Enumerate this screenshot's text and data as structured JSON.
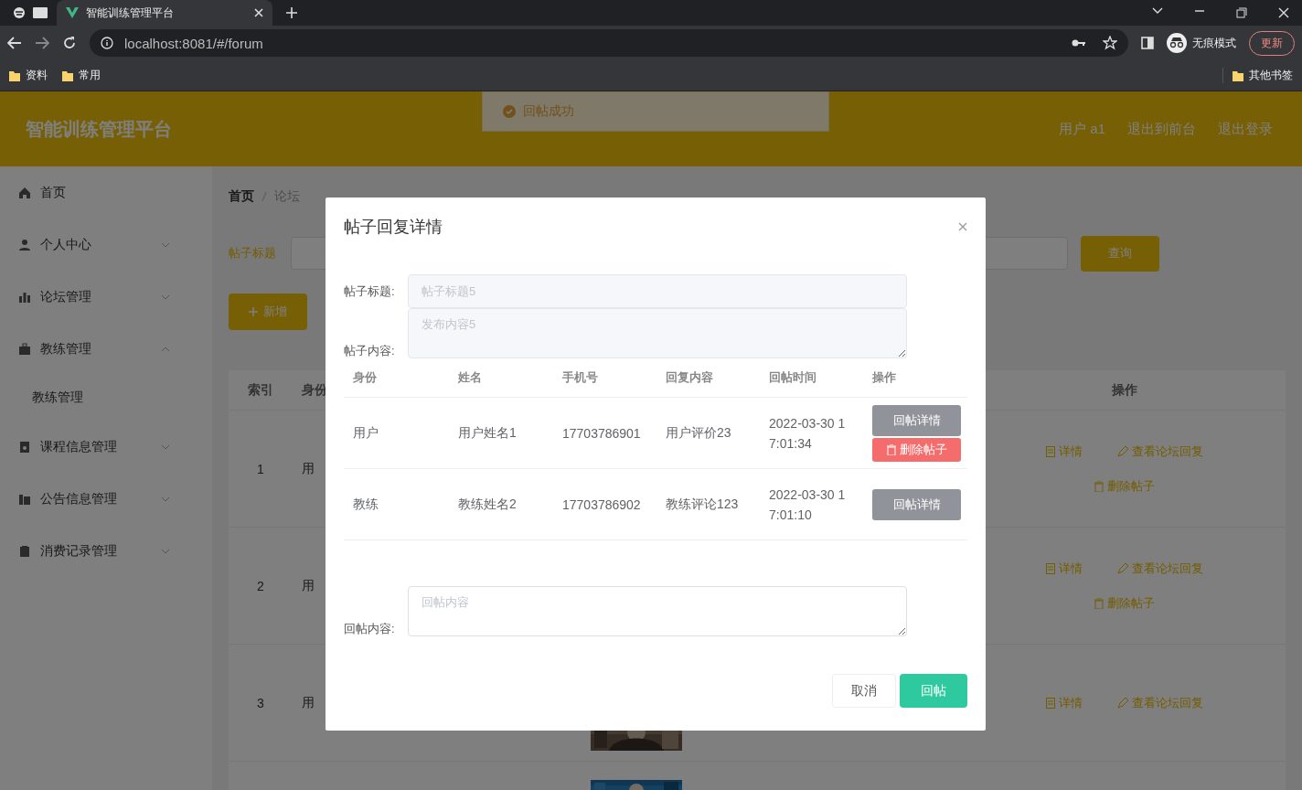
{
  "browser": {
    "tabs": [
      {
        "title": "智能训练管理平台",
        "selected": true
      }
    ],
    "url": "localhost:8081/#/forum",
    "profile": "无痕模式",
    "update_button": "更新",
    "bookmarks": [
      "资料",
      "常用"
    ],
    "other_bookmarks": "其他书签"
  },
  "app": {
    "title": "智能训练管理平台",
    "header_links": [
      "用户 a1",
      "退出到前台",
      "退出登录"
    ],
    "toast": "回帖成功",
    "sidebar": {
      "items": [
        {
          "label": "首页",
          "kind": "link"
        },
        {
          "label": "个人中心",
          "kind": "menu",
          "expanded": false
        },
        {
          "label": "论坛管理",
          "kind": "menu",
          "expanded": false
        },
        {
          "label": "教练管理",
          "kind": "menu",
          "expanded": true,
          "children": [
            {
              "label": "教练管理"
            }
          ]
        },
        {
          "label": "课程信息管理",
          "kind": "menu",
          "expanded": false
        },
        {
          "label": "公告信息管理",
          "kind": "menu",
          "expanded": false
        },
        {
          "label": "消费记录管理",
          "kind": "menu",
          "expanded": false
        }
      ]
    },
    "breadcrumb": [
      "首页",
      "论坛"
    ],
    "search": {
      "label": "帖子标题",
      "button": "查询"
    },
    "add_button": "新增",
    "table": {
      "columns": [
        "索引",
        "身份",
        "操作"
      ],
      "rows": [
        {
          "index": "1",
          "identity": "用",
          "actions": [
            {
              "label": "详情",
              "kind": "detail"
            },
            {
              "label": "查看论坛回复",
              "kind": "replies"
            },
            {
              "label": "删除帖子",
              "kind": "delete"
            }
          ]
        },
        {
          "index": "2",
          "identity": "用",
          "actions": [
            {
              "label": "详情",
              "kind": "detail"
            },
            {
              "label": "查看论坛回复",
              "kind": "replies"
            },
            {
              "label": "删除帖子",
              "kind": "delete"
            }
          ]
        },
        {
          "index": "3",
          "identity": "用",
          "picture": {
            "kind": "picture"
          },
          "actions": [
            {
              "label": "详情",
              "kind": "detail"
            },
            {
              "label": "查看论坛回复",
              "kind": "replies"
            }
          ]
        },
        {
          "picture": {
            "kind": "picture"
          }
        }
      ]
    }
  },
  "modal": {
    "title": "帖子回复详情",
    "post_title": {
      "label": "帖子标题:",
      "value": "帖子标题5",
      "disabled": true
    },
    "post_content": {
      "label": "帖子内容:",
      "value": "发布内容5",
      "disabled": true
    },
    "replies": {
      "columns": [
        "身份",
        "姓名",
        "手机号",
        "回复内容",
        "回帖时间",
        "操作"
      ],
      "rows": [
        {
          "cells": [
            "用户",
            "用户姓名1",
            "17703786901",
            "用户评价23",
            "2022-03-30 17:01:34"
          ],
          "actions": [
            {
              "label": "回帖详情",
              "kind": "detail"
            },
            {
              "label": "删除帖子",
              "kind": "delete"
            }
          ]
        },
        {
          "cells": [
            "教练",
            "教练姓名2",
            "17703786902",
            "教练评论123",
            "2022-03-30 17:01:10"
          ],
          "actions": [
            {
              "label": "回帖详情",
              "kind": "detail"
            }
          ]
        }
      ]
    },
    "reply_field": {
      "label": "回帖内容:",
      "placeholder": "回帖内容"
    },
    "buttons": [
      {
        "label": "取消",
        "kind": "cancel"
      },
      {
        "label": "回帖",
        "kind": "primary"
      }
    ]
  }
}
